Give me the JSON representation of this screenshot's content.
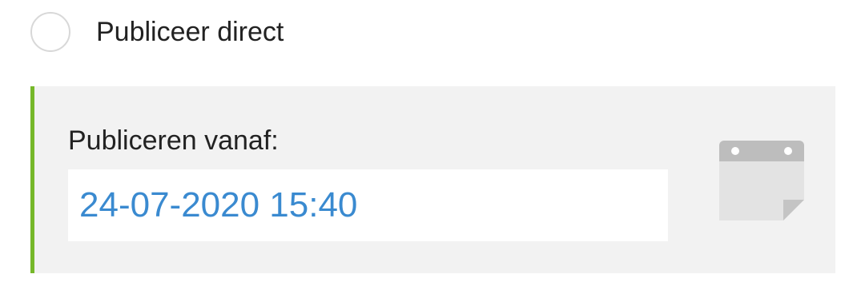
{
  "publish_option": {
    "label": "Publiceer direct",
    "selected": false
  },
  "schedule": {
    "label": "Publiceren vanaf:",
    "datetime_value": "24-07-2020 15:40",
    "accent_color": "#76b82a",
    "value_color": "#3a8ad0"
  },
  "icons": {
    "radio": "radio-circle-icon",
    "calendar": "calendar-icon"
  }
}
